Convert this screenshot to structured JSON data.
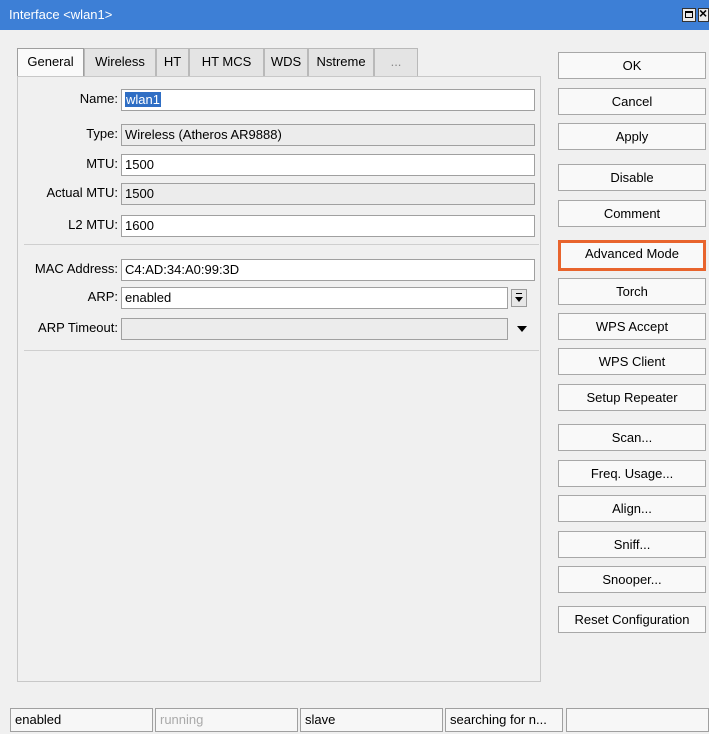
{
  "window": {
    "title": "Interface <wlan1>"
  },
  "tabs": [
    "General",
    "Wireless",
    "HT",
    "HT MCS",
    "WDS",
    "Nstreme",
    "..."
  ],
  "active_tab": "General",
  "form": {
    "name": {
      "label": "Name:",
      "value": "wlan1"
    },
    "type": {
      "label": "Type:",
      "value": "Wireless (Atheros AR9888)"
    },
    "mtu": {
      "label": "MTU:",
      "value": "1500"
    },
    "actual_mtu": {
      "label": "Actual MTU:",
      "value": "1500"
    },
    "l2_mtu": {
      "label": "L2 MTU:",
      "value": "1600"
    },
    "mac_address": {
      "label": "MAC Address:",
      "value": "C4:AD:34:A0:99:3D"
    },
    "arp": {
      "label": "ARP:",
      "value": "enabled"
    },
    "arp_timeout": {
      "label": "ARP Timeout:",
      "value": ""
    }
  },
  "buttons": {
    "ok": "OK",
    "cancel": "Cancel",
    "apply": "Apply",
    "disable": "Disable",
    "comment": "Comment",
    "advanced_mode": "Advanced Mode",
    "torch": "Torch",
    "wps_accept": "WPS Accept",
    "wps_client": "WPS Client",
    "setup_repeater": "Setup Repeater",
    "scan": "Scan...",
    "freq_usage": "Freq. Usage...",
    "align": "Align...",
    "sniff": "Sniff...",
    "snooper": "Snooper...",
    "reset_configuration": "Reset Configuration"
  },
  "highlight_color": "#e8642d",
  "status_bar": [
    "enabled",
    "running",
    "slave",
    "searching for n...",
    ""
  ]
}
